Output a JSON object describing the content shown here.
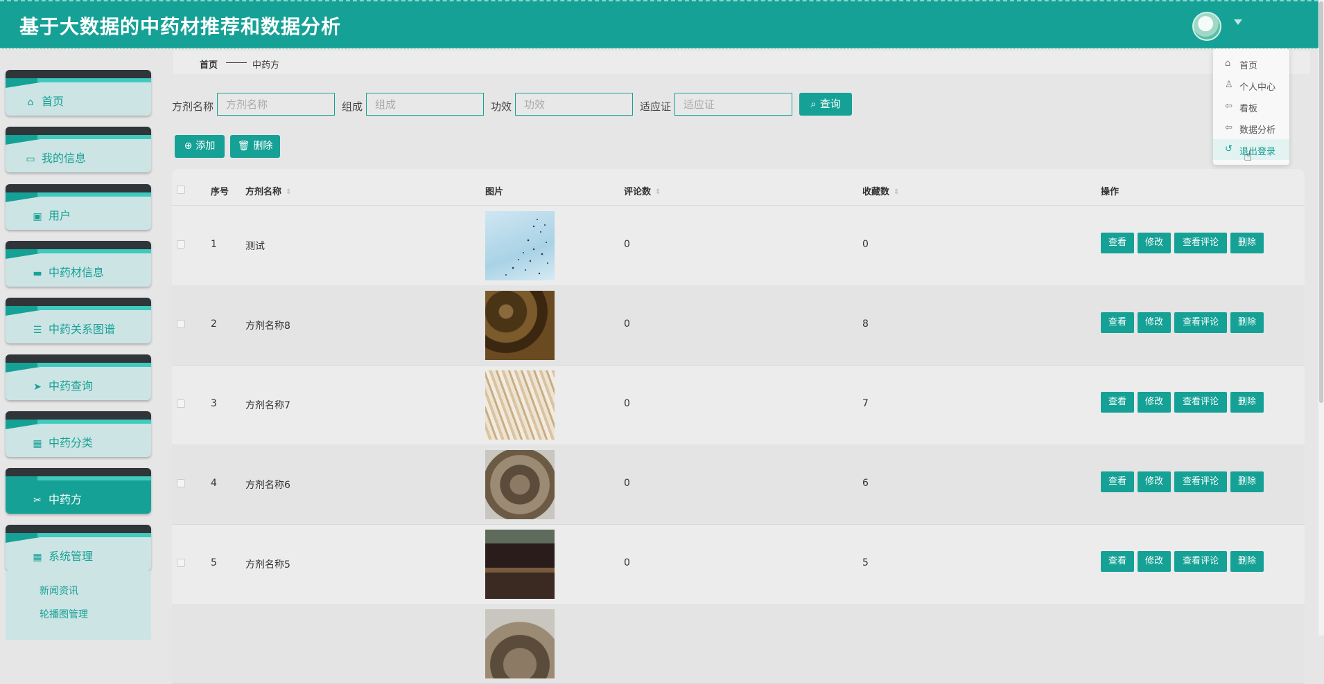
{
  "header": {
    "title": "基于大数据的中药材推荐和数据分析"
  },
  "sidebar": {
    "items": [
      {
        "label": "首页",
        "icon": "home-icon"
      },
      {
        "label": "我的信息",
        "icon": "card-icon"
      },
      {
        "label": "用户",
        "icon": "clipboard-icon"
      },
      {
        "label": "中药材信息",
        "icon": "monitor-icon"
      },
      {
        "label": "中药关系图谱",
        "icon": "list-icon"
      },
      {
        "label": "中药查询",
        "icon": "send-icon"
      },
      {
        "label": "中药分类",
        "icon": "grid-icon"
      },
      {
        "label": "中药方",
        "icon": "ticket-icon"
      },
      {
        "label": "系统管理",
        "icon": "grid-icon"
      }
    ],
    "sub_items": [
      "新闻资讯",
      "轮播图管理"
    ]
  },
  "breadcrumb": {
    "home": "首页",
    "current": "中药方"
  },
  "search": {
    "fields": [
      {
        "label": "方剂名称",
        "placeholder": "方剂名称"
      },
      {
        "label": "组成",
        "placeholder": "组成"
      },
      {
        "label": "功效",
        "placeholder": "功效"
      },
      {
        "label": "适应证",
        "placeholder": "适应证"
      }
    ],
    "button": "查询"
  },
  "toolbar": {
    "add": "添加",
    "delete": "删除"
  },
  "table": {
    "columns": [
      "序号",
      "方剂名称",
      "图片",
      "评论数",
      "收藏数",
      "操作"
    ],
    "rows": [
      {
        "index": "1",
        "name": "测试",
        "comments": "0",
        "favorites": "0"
      },
      {
        "index": "2",
        "name": "方剂名称8",
        "comments": "0",
        "favorites": "8"
      },
      {
        "index": "3",
        "name": "方剂名称7",
        "comments": "0",
        "favorites": "7"
      },
      {
        "index": "4",
        "name": "方剂名称6",
        "comments": "0",
        "favorites": "6"
      },
      {
        "index": "5",
        "name": "方剂名称5",
        "comments": "0",
        "favorites": "5"
      }
    ],
    "actions": [
      "查看",
      "修改",
      "查看评论",
      "删除"
    ]
  },
  "dropdown": {
    "items": [
      {
        "label": "首页",
        "icon": "home-icon"
      },
      {
        "label": "个人中心",
        "icon": "user-icon"
      },
      {
        "label": "看板",
        "icon": "back-arrow-icon"
      },
      {
        "label": "数据分析",
        "icon": "back-arrow-icon"
      },
      {
        "label": "退出登录",
        "icon": "logout-icon"
      }
    ]
  },
  "colors": {
    "accent": "#16a196",
    "sidebar_card": "#cde4e4"
  }
}
